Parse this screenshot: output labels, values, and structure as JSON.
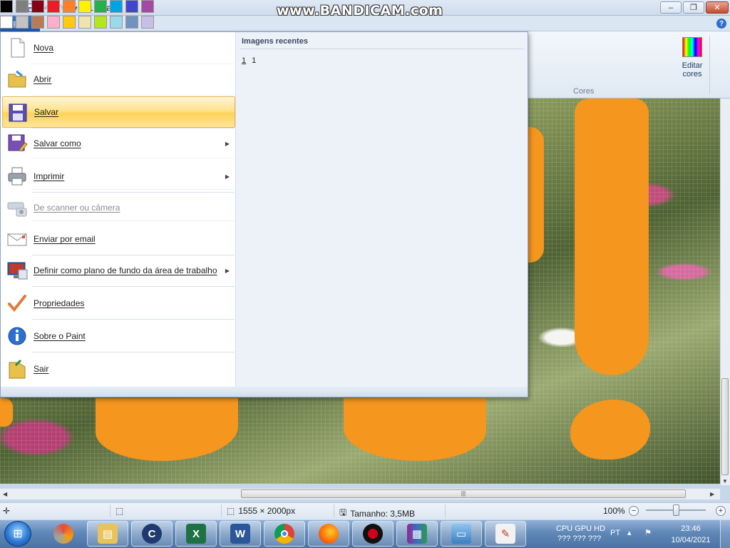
{
  "window": {
    "title": "1 - Paint",
    "watermark": "www.BANDICAM.com"
  },
  "quick_access": {
    "icons": [
      "paint-app-icon",
      "save-icon",
      "undo-icon",
      "redo-icon",
      "customize-arrow-icon"
    ]
  },
  "app_menu": {
    "button_icon": "menu-icon",
    "items": [
      {
        "label": "Nova",
        "icon": "new-file-icon",
        "submenu": false,
        "disabled": false
      },
      {
        "label": "Abrir",
        "icon": "open-folder-icon",
        "submenu": false,
        "disabled": false
      },
      {
        "label": "Salvar",
        "icon": "floppy-save-icon",
        "submenu": false,
        "disabled": false,
        "highlighted": true
      },
      {
        "label": "Salvar como",
        "icon": "save-as-icon",
        "submenu": true,
        "disabled": false
      },
      {
        "label": "Imprimir",
        "icon": "printer-icon",
        "submenu": true,
        "disabled": false
      },
      {
        "label": "De scanner ou câmera",
        "icon": "scanner-icon",
        "submenu": false,
        "disabled": true
      },
      {
        "label": "Enviar por email",
        "icon": "email-icon",
        "submenu": false,
        "disabled": false
      },
      {
        "label": "Definir como plano de fundo da área de trabalho",
        "icon": "desktop-background-icon",
        "submenu": true,
        "disabled": false
      },
      {
        "label": "Propriedades",
        "icon": "checkmark-icon",
        "submenu": false,
        "disabled": false
      },
      {
        "label": "Sobre o Paint",
        "icon": "info-icon",
        "submenu": false,
        "disabled": false
      },
      {
        "label": "Sair",
        "icon": "exit-icon",
        "submenu": false,
        "disabled": false
      }
    ],
    "recent": {
      "title": "Imagens recentes",
      "items": [
        {
          "number": "1",
          "name": "1"
        }
      ]
    }
  },
  "colors_group": {
    "label": "Cores",
    "edit_colors_line1": "Editar",
    "edit_colors_line2": "cores",
    "row1": [
      "#000000",
      "#7f7f7f",
      "#880015",
      "#ed1c24",
      "#ff7f27",
      "#fff200",
      "#22b14c",
      "#00a2e8",
      "#3f48cc",
      "#a349a4"
    ],
    "row2": [
      "#ffffff",
      "#c3c3c3",
      "#b97a57",
      "#ffaec9",
      "#ffc90e",
      "#efe4b0",
      "#b5e61d",
      "#99d9ea",
      "#7092be",
      "#c8bfe7"
    ],
    "row3": [
      "#dde6f0",
      "#dde6f0",
      "#dde6f0",
      "#dde6f0",
      "#dde6f0",
      "#dde6f0",
      "#dde6f0",
      "#dde6f0",
      "#dde6f0",
      "#dde6f0"
    ]
  },
  "statusbar": {
    "dimensions": "1555 × 2000px",
    "size": "Tamanho: 3,5MB",
    "zoom": "100%",
    "zoom_level": 0.5
  },
  "taskbar": {
    "apps": [
      "explorer-icon",
      "ccleaner-icon",
      "excel-icon",
      "word-icon",
      "chrome-icon",
      "firefox-icon",
      "bandicam-icon",
      "winrar-icon",
      "photo-viewer-icon",
      "paint-icon"
    ],
    "monitor_label": "CPU GPU HD",
    "monitor_values": "???   ???  ???",
    "language": "PT",
    "time": "23:46",
    "date": "10/04/2021"
  }
}
